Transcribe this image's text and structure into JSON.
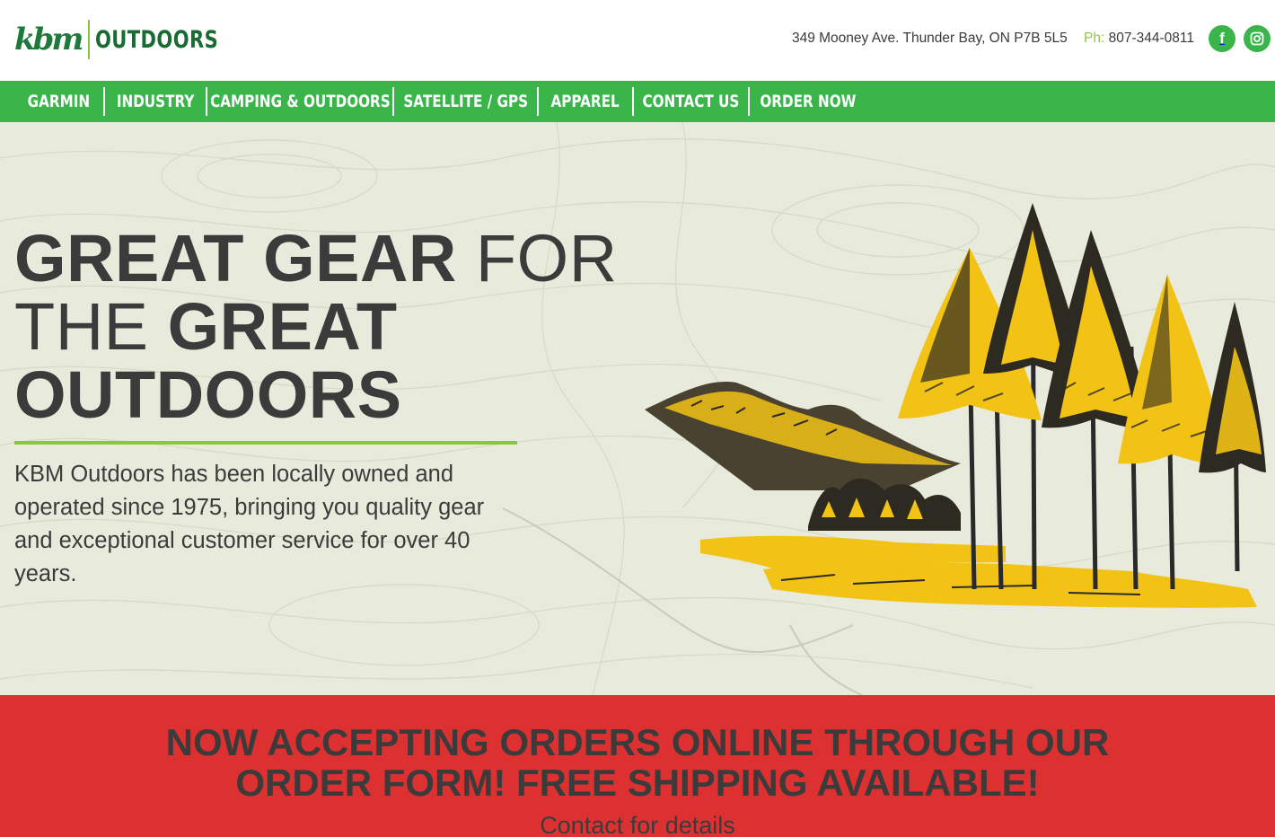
{
  "header": {
    "logo_script": "kbm",
    "logo_word": "OUTDOORS",
    "address": "349 Mooney Ave. Thunder Bay, ON P7B 5L5",
    "phone_label": "Ph:",
    "phone": "807-344-0811",
    "social": [
      {
        "icon": "facebook-icon",
        "glyph": "f"
      },
      {
        "icon": "instagram-icon"
      }
    ]
  },
  "nav": {
    "items": [
      {
        "label": "GARMIN"
      },
      {
        "label": "INDUSTRY"
      },
      {
        "label": "CAMPING & OUTDOORS"
      },
      {
        "label": "SATELLITE / GPS"
      },
      {
        "label": "APPAREL"
      },
      {
        "label": "CONTACT US"
      },
      {
        "label": "ORDER NOW"
      }
    ]
  },
  "hero": {
    "title_bold_1": "GREAT GEAR",
    "title_light_1": " FOR",
    "title_light_2": "THE ",
    "title_bold_2": "GREAT",
    "title_bold_3": "OUTDOORS",
    "body": "KBM Outdoors has been locally owned and operated since 1975, bringing you quality gear and exceptional customer service for over 40 years."
  },
  "banner": {
    "headline": "NOW ACCEPTING ORDERS ONLINE THROUGH OUR ORDER FORM! FREE SHIPPING AVAILABLE!",
    "subtext": "Contact for details"
  },
  "colors": {
    "brand_green": "#39b54a",
    "accent_lime": "#8cc63f",
    "logo_green": "#1a6b33",
    "banner_red": "#dd3131",
    "text_dark": "#3b3b3b",
    "hero_bg": "#e8eadb"
  }
}
